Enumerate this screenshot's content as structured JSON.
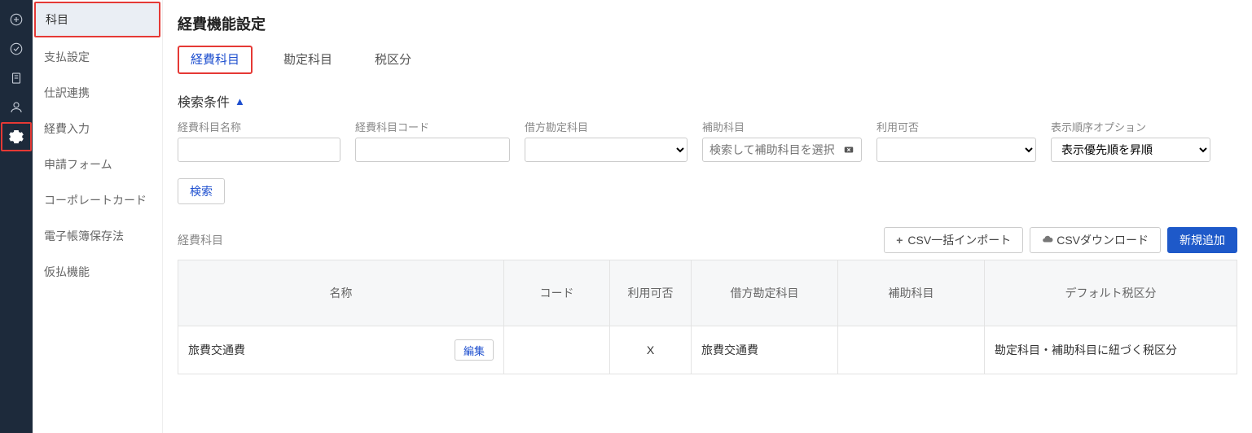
{
  "page_title": "経費機能設定",
  "rail_icons": [
    "plus-circle",
    "check-circle",
    "receipt",
    "person",
    "gear"
  ],
  "sidebar": {
    "items": [
      {
        "label": "科目",
        "highlighted": true
      },
      {
        "label": "支払設定"
      },
      {
        "label": "仕訳連携"
      },
      {
        "label": "経費入力"
      },
      {
        "label": "申請フォーム"
      },
      {
        "label": "コーポレートカード"
      },
      {
        "label": "電子帳簿保存法"
      },
      {
        "label": "仮払機能"
      }
    ]
  },
  "tabs": [
    {
      "label": "経費科目",
      "active": true,
      "highlighted": true
    },
    {
      "label": "勘定科目"
    },
    {
      "label": "税区分"
    }
  ],
  "search": {
    "header": "検索条件",
    "filters": {
      "name_label": "経費科目名称",
      "code_label": "経費科目コード",
      "debit_label": "借方勘定科目",
      "sub_label": "補助科目",
      "sub_placeholder": "検索して補助科目を選択",
      "usable_label": "利用可否",
      "sort_label": "表示順序オプション",
      "sort_value": "表示優先順を昇順"
    },
    "button": "検索"
  },
  "list": {
    "title": "経費科目",
    "csv_import": "CSV一括インポート",
    "csv_download": "CSVダウンロード",
    "add_new": "新規追加",
    "columns": [
      "名称",
      "コード",
      "利用可否",
      "借方勘定科目",
      "補助科目",
      "デフォルト税区分"
    ],
    "edit_label": "編集",
    "rows": [
      {
        "name": "旅費交通費",
        "code": "",
        "usable": "X",
        "debit": "旅費交通費",
        "sub": "",
        "tax": "勘定科目・補助科目に紐づく税区分"
      }
    ]
  }
}
